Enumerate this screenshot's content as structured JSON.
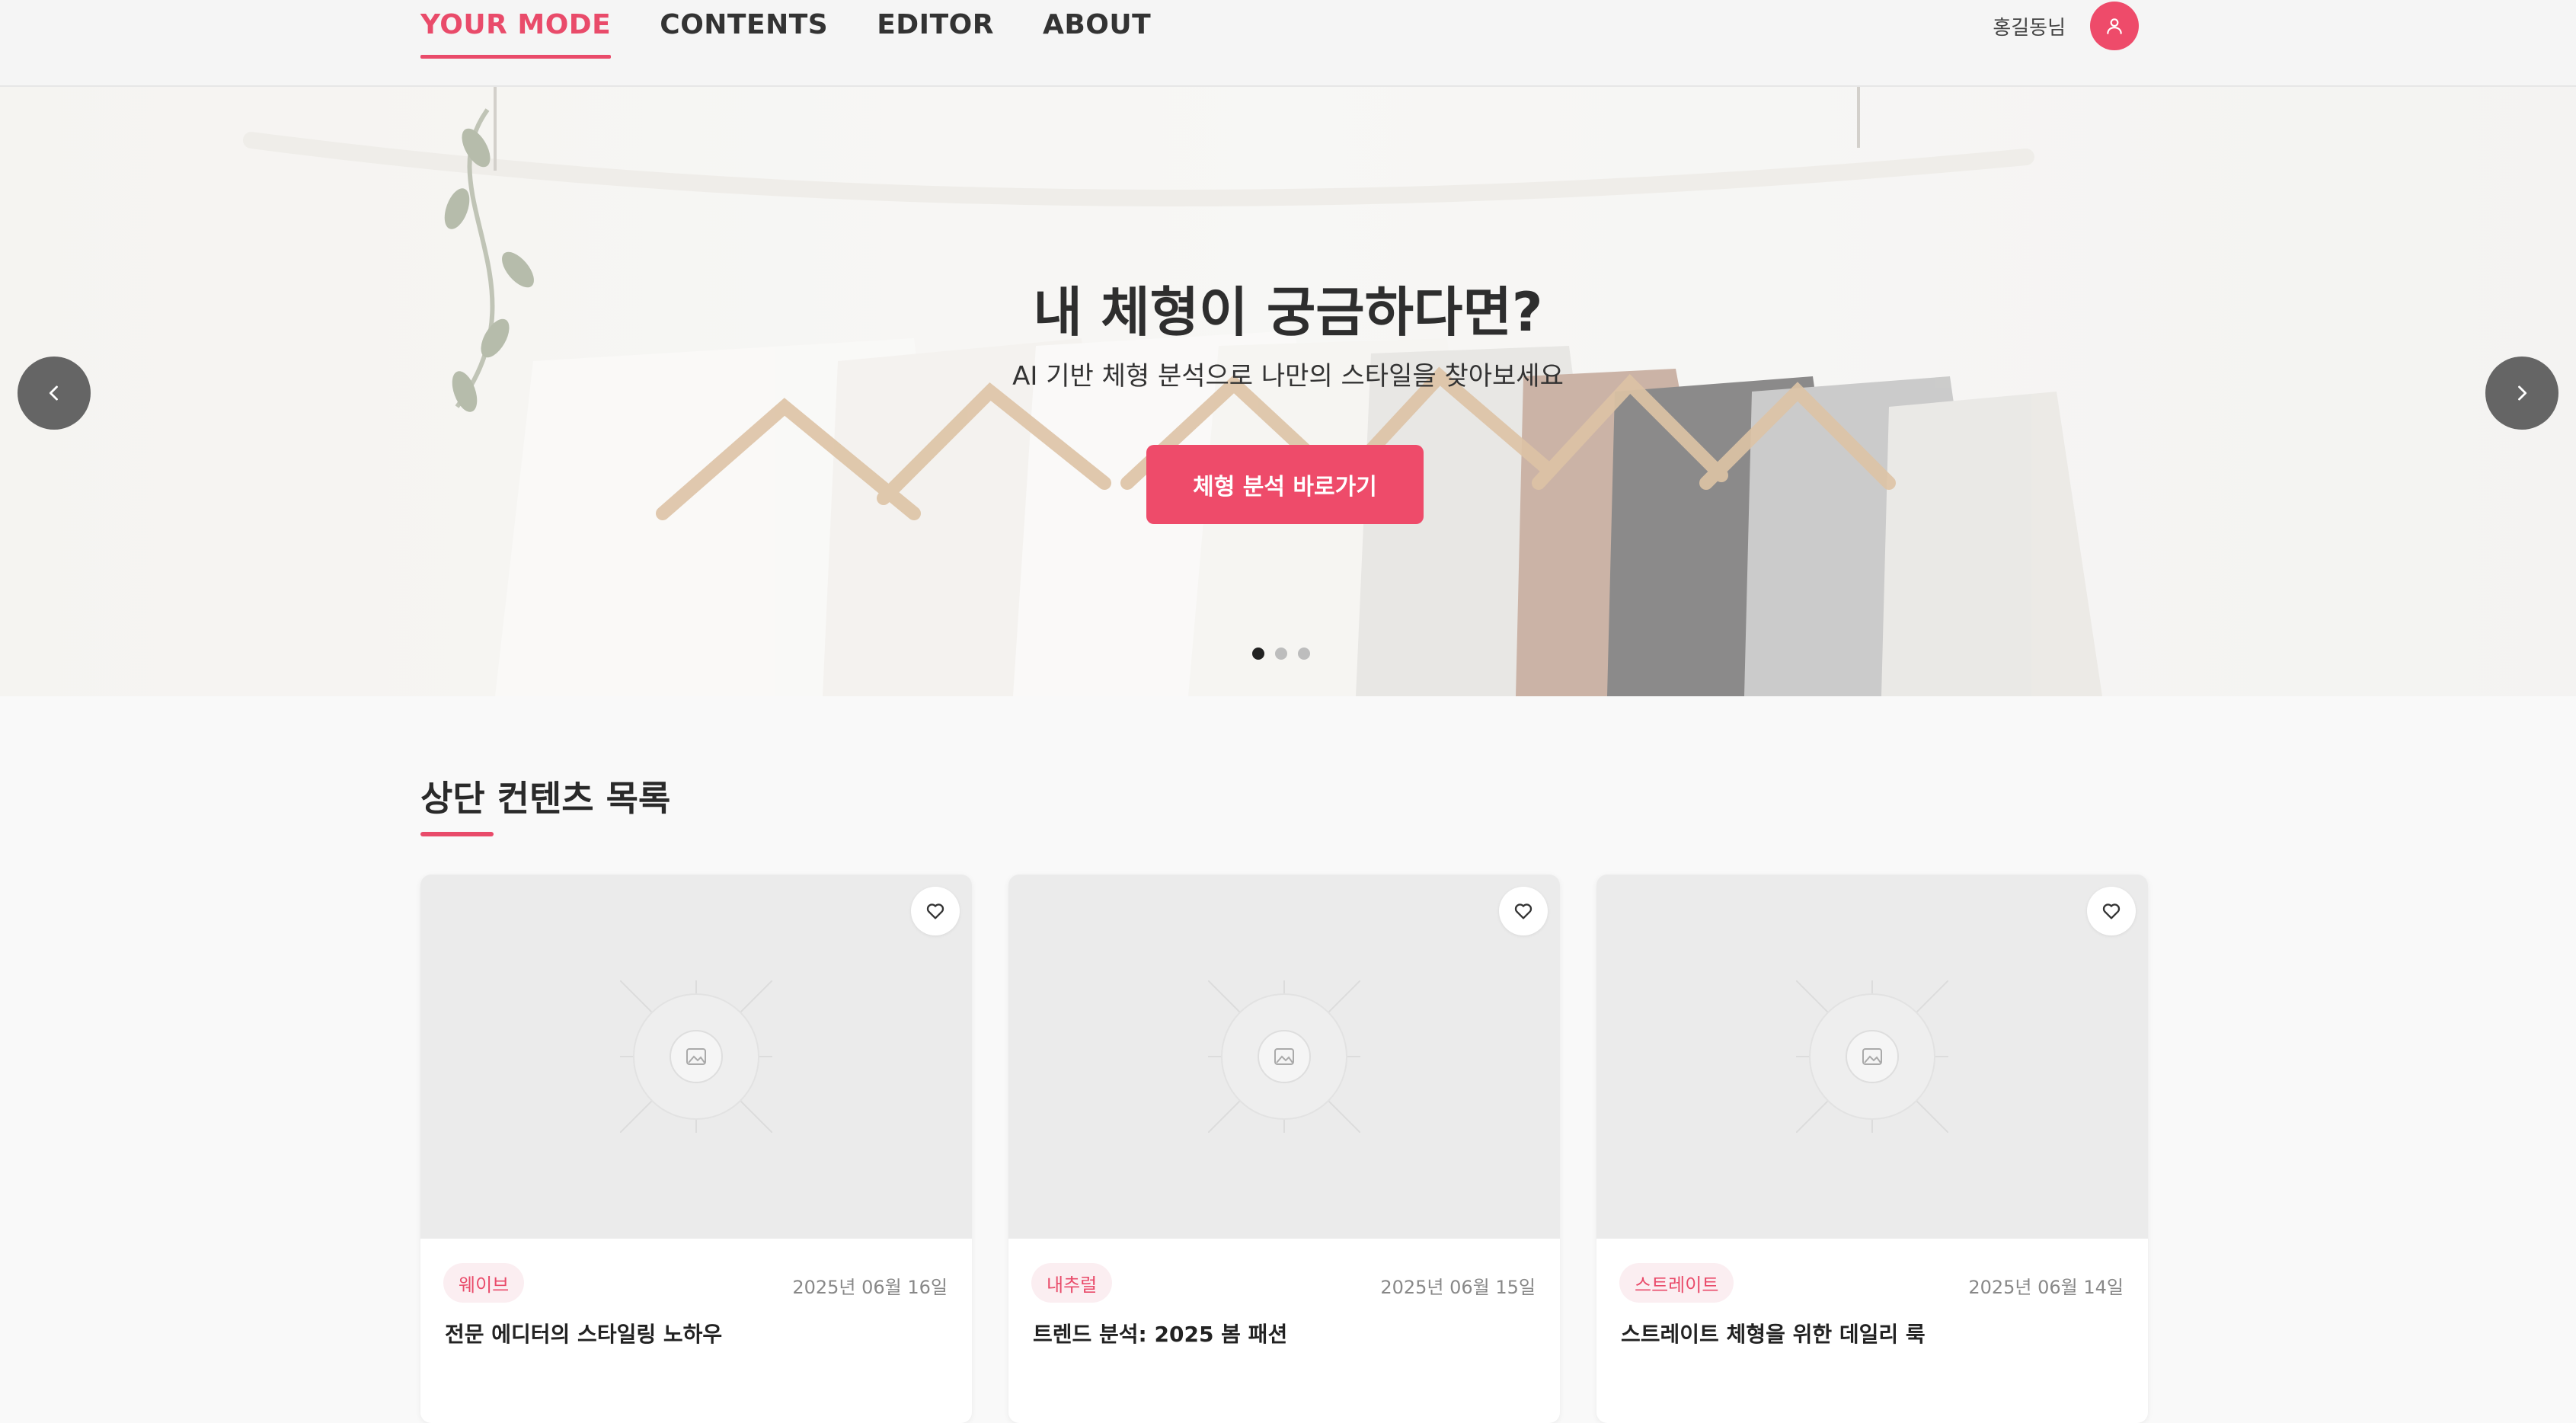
{
  "colors": {
    "accent": "#ee4b6a",
    "text": "#222222",
    "tag_bg": "#fbeef1"
  },
  "nav": {
    "items": [
      {
        "label": "YOUR MODE",
        "active": true
      },
      {
        "label": "CONTENTS",
        "active": false
      },
      {
        "label": "EDITOR",
        "active": false
      },
      {
        "label": "ABOUT",
        "active": false
      }
    ]
  },
  "user": {
    "name": "홍길동님",
    "icon": "user-icon"
  },
  "hero": {
    "title": "내 체형이 궁금하다면?",
    "subtitle": "AI 기반 체형 분석으로 나만의 스타일을 찾아보세요",
    "cta_label": "체형 분석 바로가기",
    "prev_icon": "chevron-left-icon",
    "next_icon": "chevron-right-icon",
    "slide_count": 3,
    "active_slide": 1
  },
  "section": {
    "title": "상단 컨텐츠 목록"
  },
  "cards": [
    {
      "tag": "웨이브",
      "date": "2025년 06월 16일",
      "title": "전문 에디터의 스타일링 노하우"
    },
    {
      "tag": "내추럴",
      "date": "2025년 06월 15일",
      "title": "트렌드 분석: 2025 봄 패션"
    },
    {
      "tag": "스트레이트",
      "date": "2025년 06월 14일",
      "title": "스트레이트 체형을 위한 데일리 룩"
    }
  ]
}
